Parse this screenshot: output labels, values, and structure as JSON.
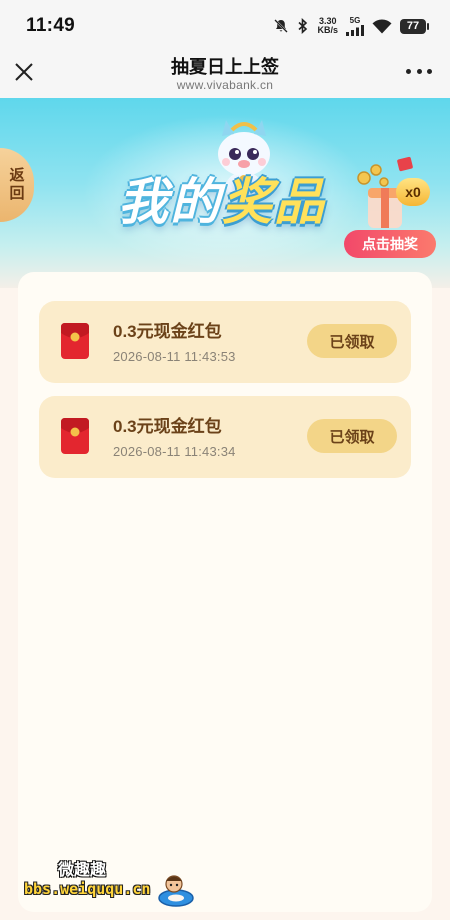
{
  "status_bar": {
    "time": "11:49",
    "speed_value": "3.30",
    "speed_unit": "KB/s",
    "signal_label": "5G",
    "battery": "77"
  },
  "nav": {
    "title": "抽夏日上上签",
    "subtitle": "www.vivabank.cn"
  },
  "hero": {
    "back_label_1": "返",
    "back_label_2": "回",
    "title_part1": "我的",
    "title_part2": "奖品",
    "prize_count": "x0",
    "draw_button": "点击抽奖"
  },
  "prizes": [
    {
      "name": "0.3元现金红包",
      "time": "2026-08-11 11:43:53",
      "status": "已领取"
    },
    {
      "name": "0.3元现金红包",
      "time": "2026-08-11 11:43:34",
      "status": "已领取"
    }
  ],
  "watermark": {
    "name": "微趣趣",
    "url": "bbs.weiququ.cn"
  },
  "colors": {
    "accent_pink": "#f2486a",
    "card_bg": "#fbeccb",
    "claim_btn": "#f3d588",
    "hero_sky": "#5fd7ec"
  }
}
